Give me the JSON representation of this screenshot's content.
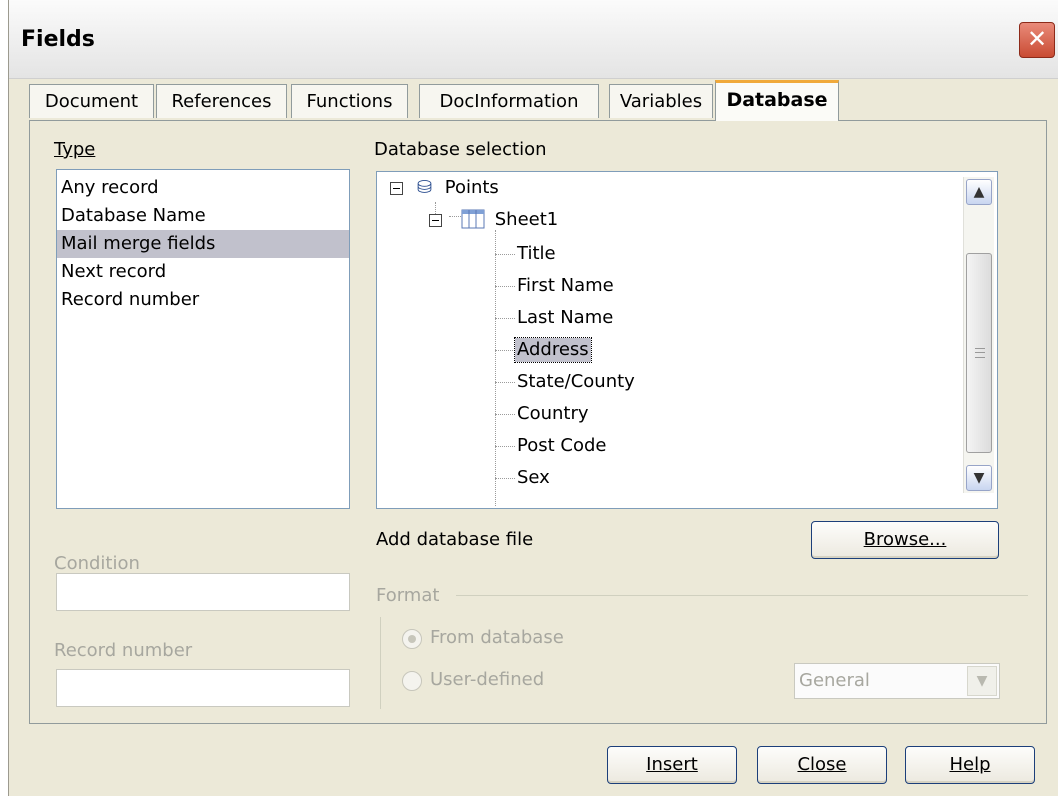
{
  "window": {
    "title": "Fields",
    "close_glyph": "✕"
  },
  "tabs": [
    {
      "label": "Document"
    },
    {
      "label": "References"
    },
    {
      "label": "Functions"
    },
    {
      "label": "DocInformation"
    },
    {
      "label": "Variables"
    },
    {
      "label": "Database",
      "active": true
    }
  ],
  "type_section": {
    "label": "Type",
    "items": [
      "Any record",
      "Database Name",
      "Mail merge fields",
      "Next record",
      "Record number"
    ],
    "selected": "Mail merge fields"
  },
  "condition": {
    "label": "Condition",
    "value": ""
  },
  "record_number": {
    "label": "Record number",
    "value": ""
  },
  "database_selection": {
    "label": "Database selection",
    "root": {
      "label": "Points",
      "icon": "database-icon"
    },
    "table": {
      "label": "Sheet1",
      "icon": "table-icon"
    },
    "fields": [
      "Title",
      "First Name",
      "Last Name",
      "Address",
      "State/County",
      "Country",
      "Post Code",
      "Sex"
    ],
    "selected_field": "Address"
  },
  "add_database": {
    "label": "Add database file",
    "browse_label": "Browse..."
  },
  "format": {
    "label": "Format",
    "options": [
      "From database",
      "User-defined"
    ],
    "selected": "From database",
    "select_value": "General"
  },
  "footer": {
    "insert_label": "Insert",
    "close_label": "Close",
    "help_label": "Help"
  }
}
